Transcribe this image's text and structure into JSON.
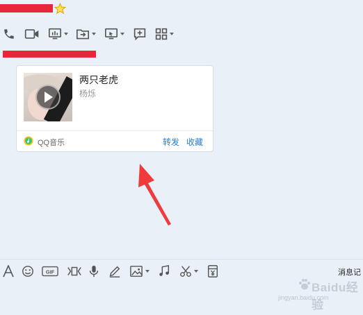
{
  "chat": {
    "contact_name_redacted": "",
    "card": {
      "song_title": "两只老虎",
      "artist": "杨烁",
      "source": "QQ音乐",
      "actions": {
        "forward": "转发",
        "favorite": "收藏"
      }
    }
  },
  "toolbar_icons": [
    "phone-icon",
    "video-call-icon",
    "remote-assist-icon",
    "file-transfer-icon",
    "screen-share-icon",
    "add-app-icon",
    "more-apps-icon"
  ],
  "input_toolbar": {
    "history_label": "消息记"
  },
  "watermark": {
    "text": "Baidu经验",
    "url": "jingyan.baidu.com"
  },
  "colors": {
    "redaction": "#e8283a",
    "link": "#2d7ec6",
    "background": "#eaf0f8",
    "arrow": "#ef3b3b"
  }
}
